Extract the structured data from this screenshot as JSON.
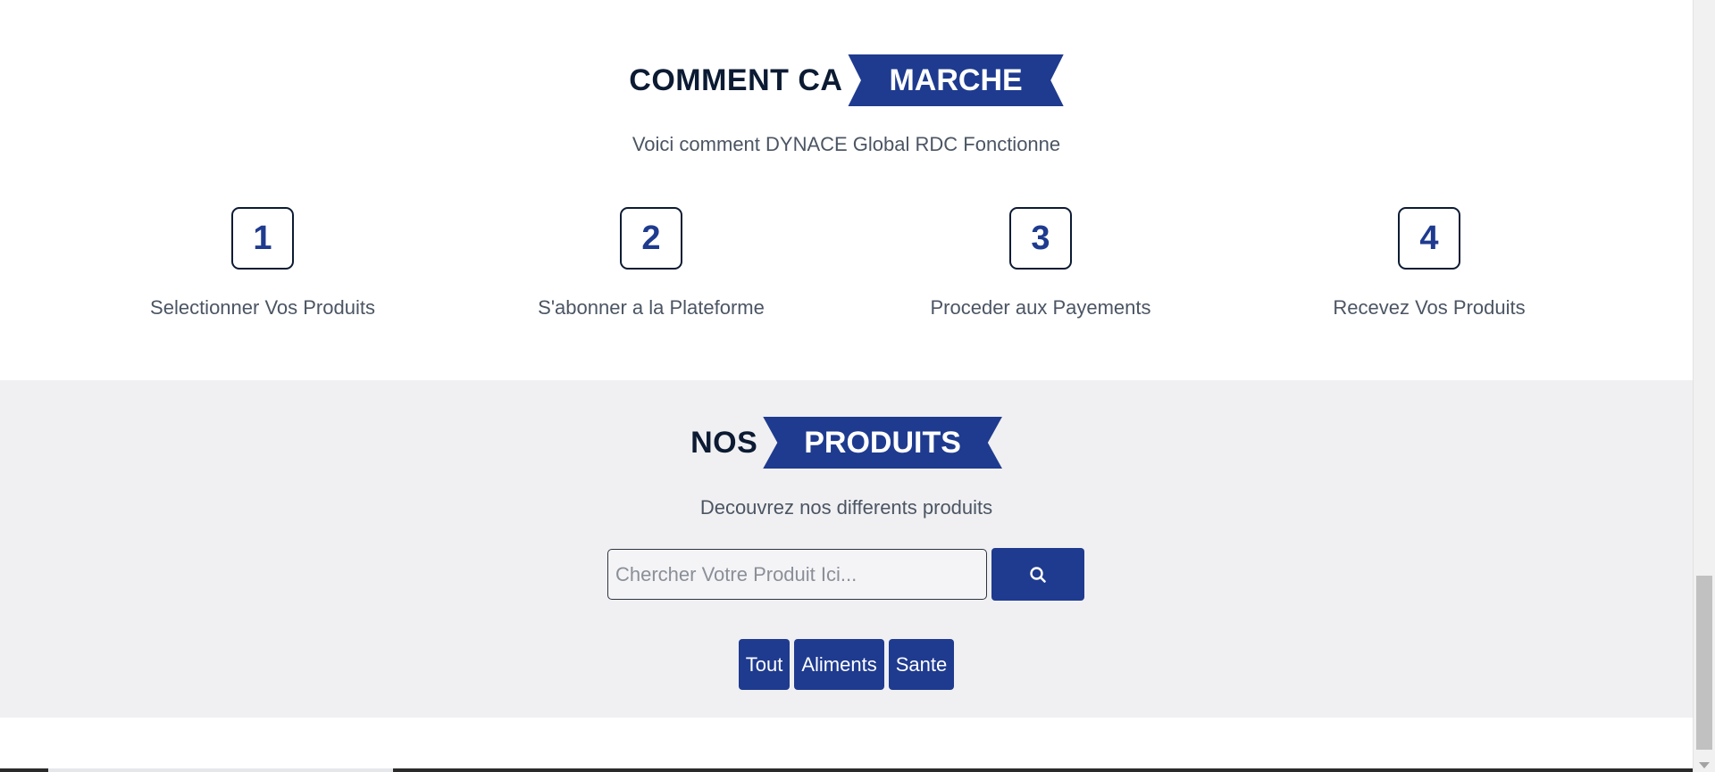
{
  "how_it_works": {
    "title_plain": "COMMENT CA",
    "title_highlight": "MARCHE",
    "subtitle": "Voici comment DYNACE Global RDC Fonctionne",
    "steps": [
      {
        "number": "1",
        "label": "Selectionner Vos Produits"
      },
      {
        "number": "2",
        "label": "S'abonner a la Plateforme"
      },
      {
        "number": "3",
        "label": "Proceder aux Payements"
      },
      {
        "number": "4",
        "label": "Recevez Vos Produits"
      }
    ]
  },
  "products": {
    "title_plain": "NOS",
    "title_highlight": "PRODUITS",
    "subtitle": "Decouvrez nos differents produits",
    "search": {
      "placeholder": "Chercher Votre Produit Ici...",
      "value": "",
      "button_icon": "search-icon"
    },
    "filters": [
      {
        "label": "Tout"
      },
      {
        "label": "Aliments"
      },
      {
        "label": "Sante"
      }
    ]
  },
  "colors": {
    "accent": "#1f3b8f",
    "heading": "#0c1b33",
    "muted_text": "#4b5563",
    "section_bg": "#f0f0f2"
  }
}
